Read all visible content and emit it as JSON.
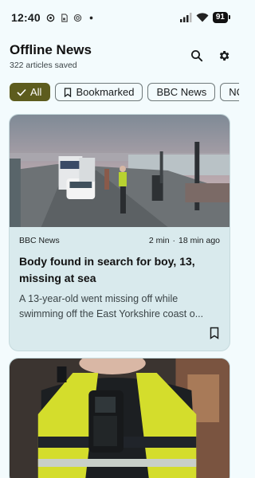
{
  "status_bar": {
    "time": "12:40",
    "battery": "91",
    "icons": [
      "notification-dot-icon",
      "sd-card-icon",
      "at-sign-icon",
      "dot-icon",
      "signal-icon",
      "wifi-icon",
      "battery-icon"
    ]
  },
  "header": {
    "title": "Offline News",
    "subtitle": "322 articles saved",
    "actions": [
      "search-icon",
      "settings-gear-icon"
    ]
  },
  "filters": {
    "chips": [
      {
        "label": "All",
        "selected": true,
        "icon": "check-icon"
      },
      {
        "label": "Bookmarked",
        "selected": false,
        "icon": "bookmark-outline-icon"
      },
      {
        "label": "BBC News",
        "selected": false
      },
      {
        "label": "NC",
        "selected": false
      }
    ]
  },
  "articles": [
    {
      "source": "BBC News",
      "read_time": "2 min",
      "separator": "·",
      "age": "18 min ago",
      "title": "Body found in search for boy, 13, missing at sea",
      "summary_line1": "A 13-year-old went missing off while",
      "summary_line2": "swimming off the East Yorkshire coast o...",
      "image": "seafront-police-scene-photo"
    },
    {
      "image": "police-officer-radio-photo"
    }
  ],
  "colors": {
    "background": "#f3fbfd",
    "card": "#d9eaed",
    "chip_selected": "#5d5c1e",
    "text": "#191c1d"
  }
}
